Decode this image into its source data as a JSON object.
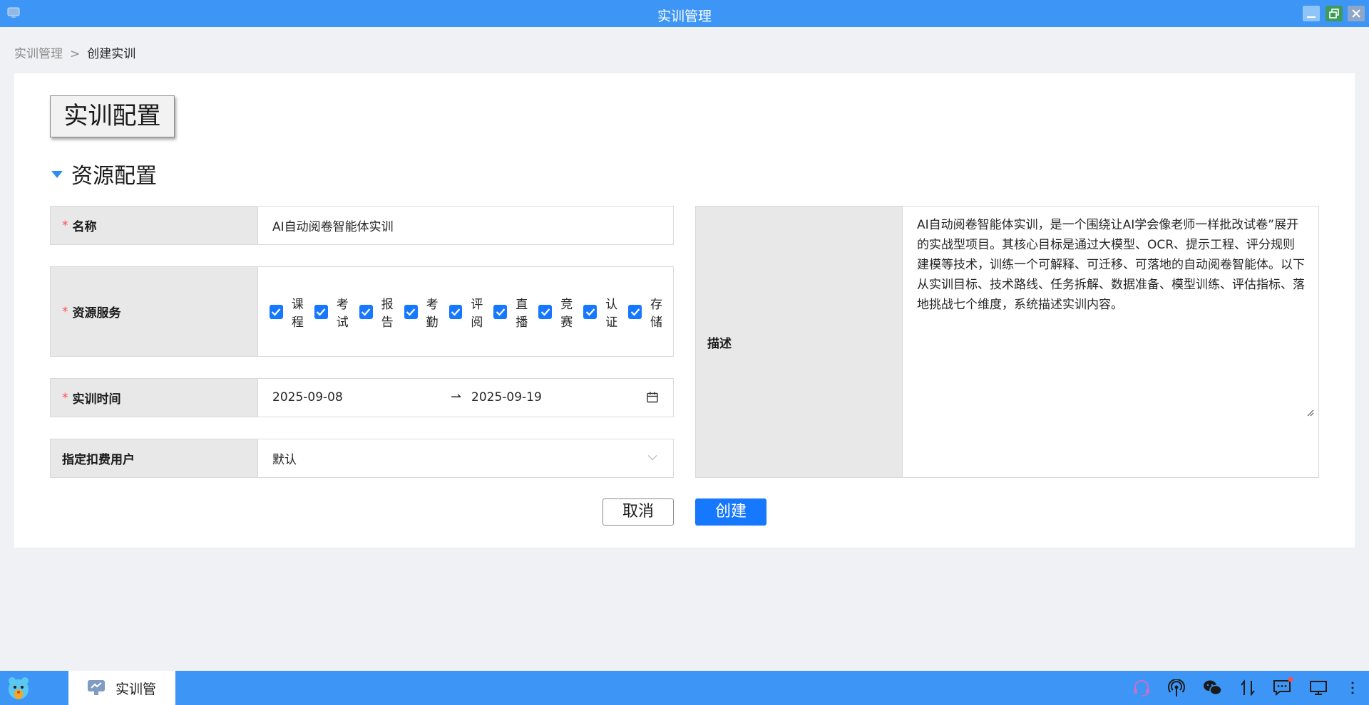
{
  "window": {
    "title": "实训管理"
  },
  "breadcrumb": {
    "items": [
      "实训管理",
      "创建实训"
    ],
    "separator": ">"
  },
  "tab": {
    "label": "实训配置"
  },
  "section": {
    "title": "资源配置"
  },
  "form": {
    "name": {
      "label": "名称",
      "required_mark": "*",
      "value": "AI自动阅卷智能体实训"
    },
    "services": {
      "label": "资源服务",
      "required_mark": "*",
      "options": [
        {
          "label": "课程",
          "checked": true
        },
        {
          "label": "考试",
          "checked": true
        },
        {
          "label": "报告",
          "checked": true
        },
        {
          "label": "考勤",
          "checked": true
        },
        {
          "label": "评阅",
          "checked": true
        },
        {
          "label": "直播",
          "checked": true
        },
        {
          "label": "竞赛",
          "checked": true
        },
        {
          "label": "认证",
          "checked": true
        },
        {
          "label": "存储",
          "checked": true
        }
      ]
    },
    "time": {
      "label": "实训时间",
      "required_mark": "*",
      "start": "2025-09-08",
      "end": "2025-09-19",
      "arrow": "⇀"
    },
    "user": {
      "label": "指定扣费用户",
      "value": "默认"
    },
    "description": {
      "label": "描述",
      "value": "AI自动阅卷智能体实训，是一个围绕让AI学会像老师一样批改试卷”展开的实战型项目。其核心目标是通过大模型、OCR、提示工程、评分规则建模等技术，训练一个可解释、可迁移、可落地的自动阅卷智能体。以下从实训目标、技术路线、任务拆解、数据准备、模型训练、评估指标、落地挑战七个维度，系统描述实训内容。"
    }
  },
  "buttons": {
    "cancel": "取消",
    "create": "创建"
  },
  "taskbar": {
    "active_task": "实训管"
  },
  "colors": {
    "accent": "#1677ff",
    "titlebar": "#3d96f6",
    "required": "#ff4d4f"
  }
}
